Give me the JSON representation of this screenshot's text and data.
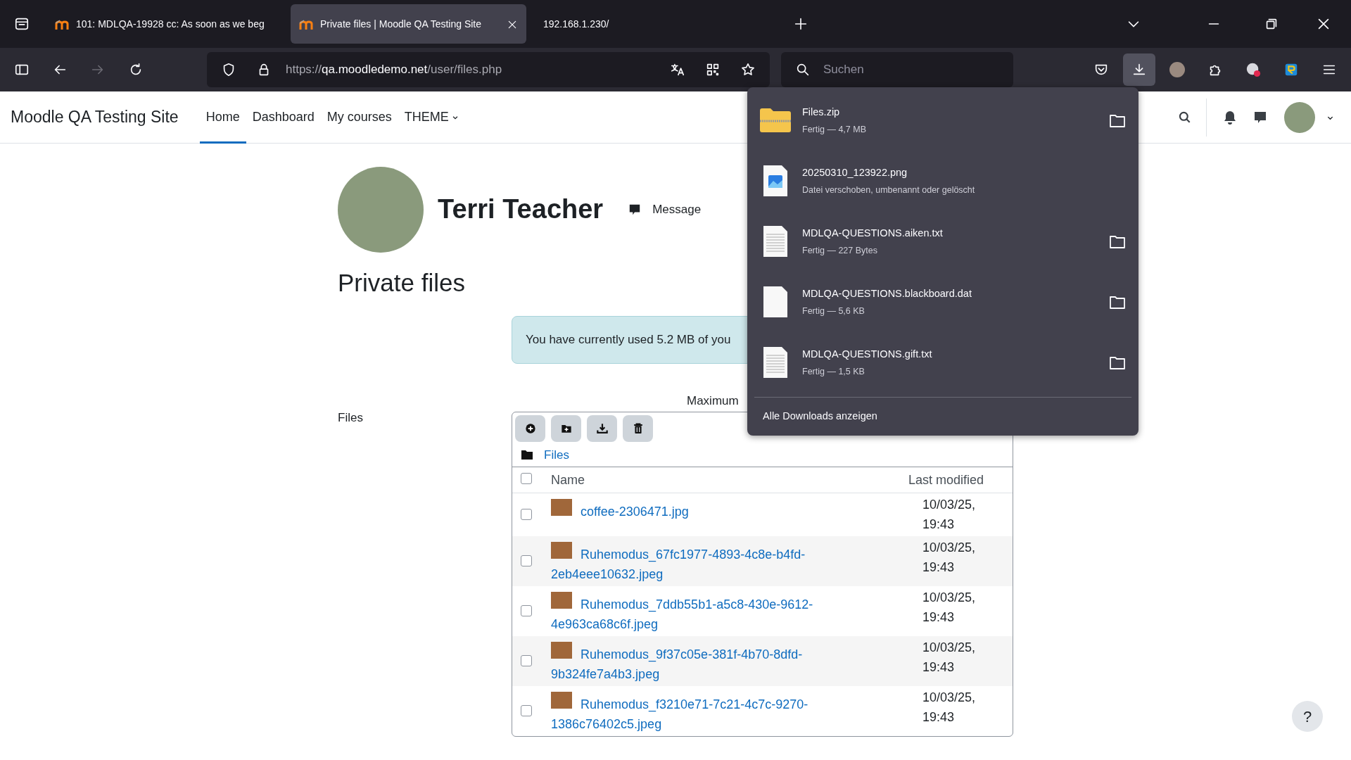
{
  "browser": {
    "tabs": [
      {
        "title": "101: MDLQA-19928 cc: As soon as we beg",
        "selected": false,
        "favicon": true
      },
      {
        "title": "Private files | Moodle QA Testing Site",
        "selected": true,
        "favicon": true
      },
      {
        "title": "192.168.1.230/",
        "selected": false,
        "favicon": false
      }
    ],
    "nav_buttons": [
      {
        "kind": "back",
        "disabled": false
      },
      {
        "kind": "forward",
        "disabled": true
      },
      {
        "kind": "reload",
        "disabled": false
      }
    ],
    "url": {
      "scheme": "https://",
      "host": "qa.moodledemo.net",
      "path": "/user/files.php"
    },
    "search": {
      "placeholder": "Suchen"
    }
  },
  "downloads_panel": {
    "open": true,
    "items": [
      {
        "kind": "zip",
        "name": "Files.zip",
        "status": "Fertig — 4,7 MB",
        "has_folder": true
      },
      {
        "kind": "image",
        "name": "20250310_123922.png",
        "status": "Datei verschoben, umbenannt oder gelöscht",
        "has_folder": false
      },
      {
        "kind": "text",
        "name": "MDLQA-QUESTIONS.aiken.txt",
        "status": "Fertig — 227 Bytes",
        "has_folder": true
      },
      {
        "kind": "blank",
        "name": "MDLQA-QUESTIONS.blackboard.dat",
        "status": "Fertig — 5,6 KB",
        "has_folder": true
      },
      {
        "kind": "text",
        "name": "MDLQA-QUESTIONS.gift.txt",
        "status": "Fertig — 1,5 KB",
        "has_folder": true
      }
    ],
    "footer": "Alle Downloads anzeigen"
  },
  "site": {
    "name": "Moodle QA Testing Site",
    "nav": [
      {
        "label": "Home",
        "selected": true,
        "dropdown": false
      },
      {
        "label": "Dashboard",
        "selected": false,
        "dropdown": false
      },
      {
        "label": "My courses",
        "selected": false,
        "dropdown": false
      },
      {
        "label": "THEME",
        "selected": false,
        "dropdown": true
      }
    ]
  },
  "profile": {
    "name": "Terri Teacher",
    "message": "Message"
  },
  "page_title": "Private files",
  "alert": "You have currently used 5.2 MB of you",
  "form": {
    "label": "Files",
    "maximum": "Maximum",
    "breadcrumb": "Files",
    "select_all_checked": false,
    "columns": [
      "Name",
      "Last modified"
    ],
    "files": [
      {
        "name": "coffee-2306471.jpg",
        "modified": "10/03/25, 19:43",
        "checked": false
      },
      {
        "name": "Ruhemodus_67fc1977-4893-4c8e-b4fd-2eb4eee10632.jpeg",
        "modified": "10/03/25, 19:43",
        "checked": false
      },
      {
        "name": "Ruhemodus_7ddb55b1-a5c8-430e-9612-4e963ca68c6f.jpeg",
        "modified": "10/03/25, 19:43",
        "checked": false
      },
      {
        "name": "Ruhemodus_9f37c05e-381f-4b70-8dfd-9b324fe7a4b3.jpeg",
        "modified": "10/03/25, 19:43",
        "checked": false
      },
      {
        "name": "Ruhemodus_f3210e71-7c21-4c7c-9270-1386c76402c5.jpeg",
        "modified": "10/03/25, 19:43",
        "checked": false
      }
    ]
  },
  "help_button": "?"
}
